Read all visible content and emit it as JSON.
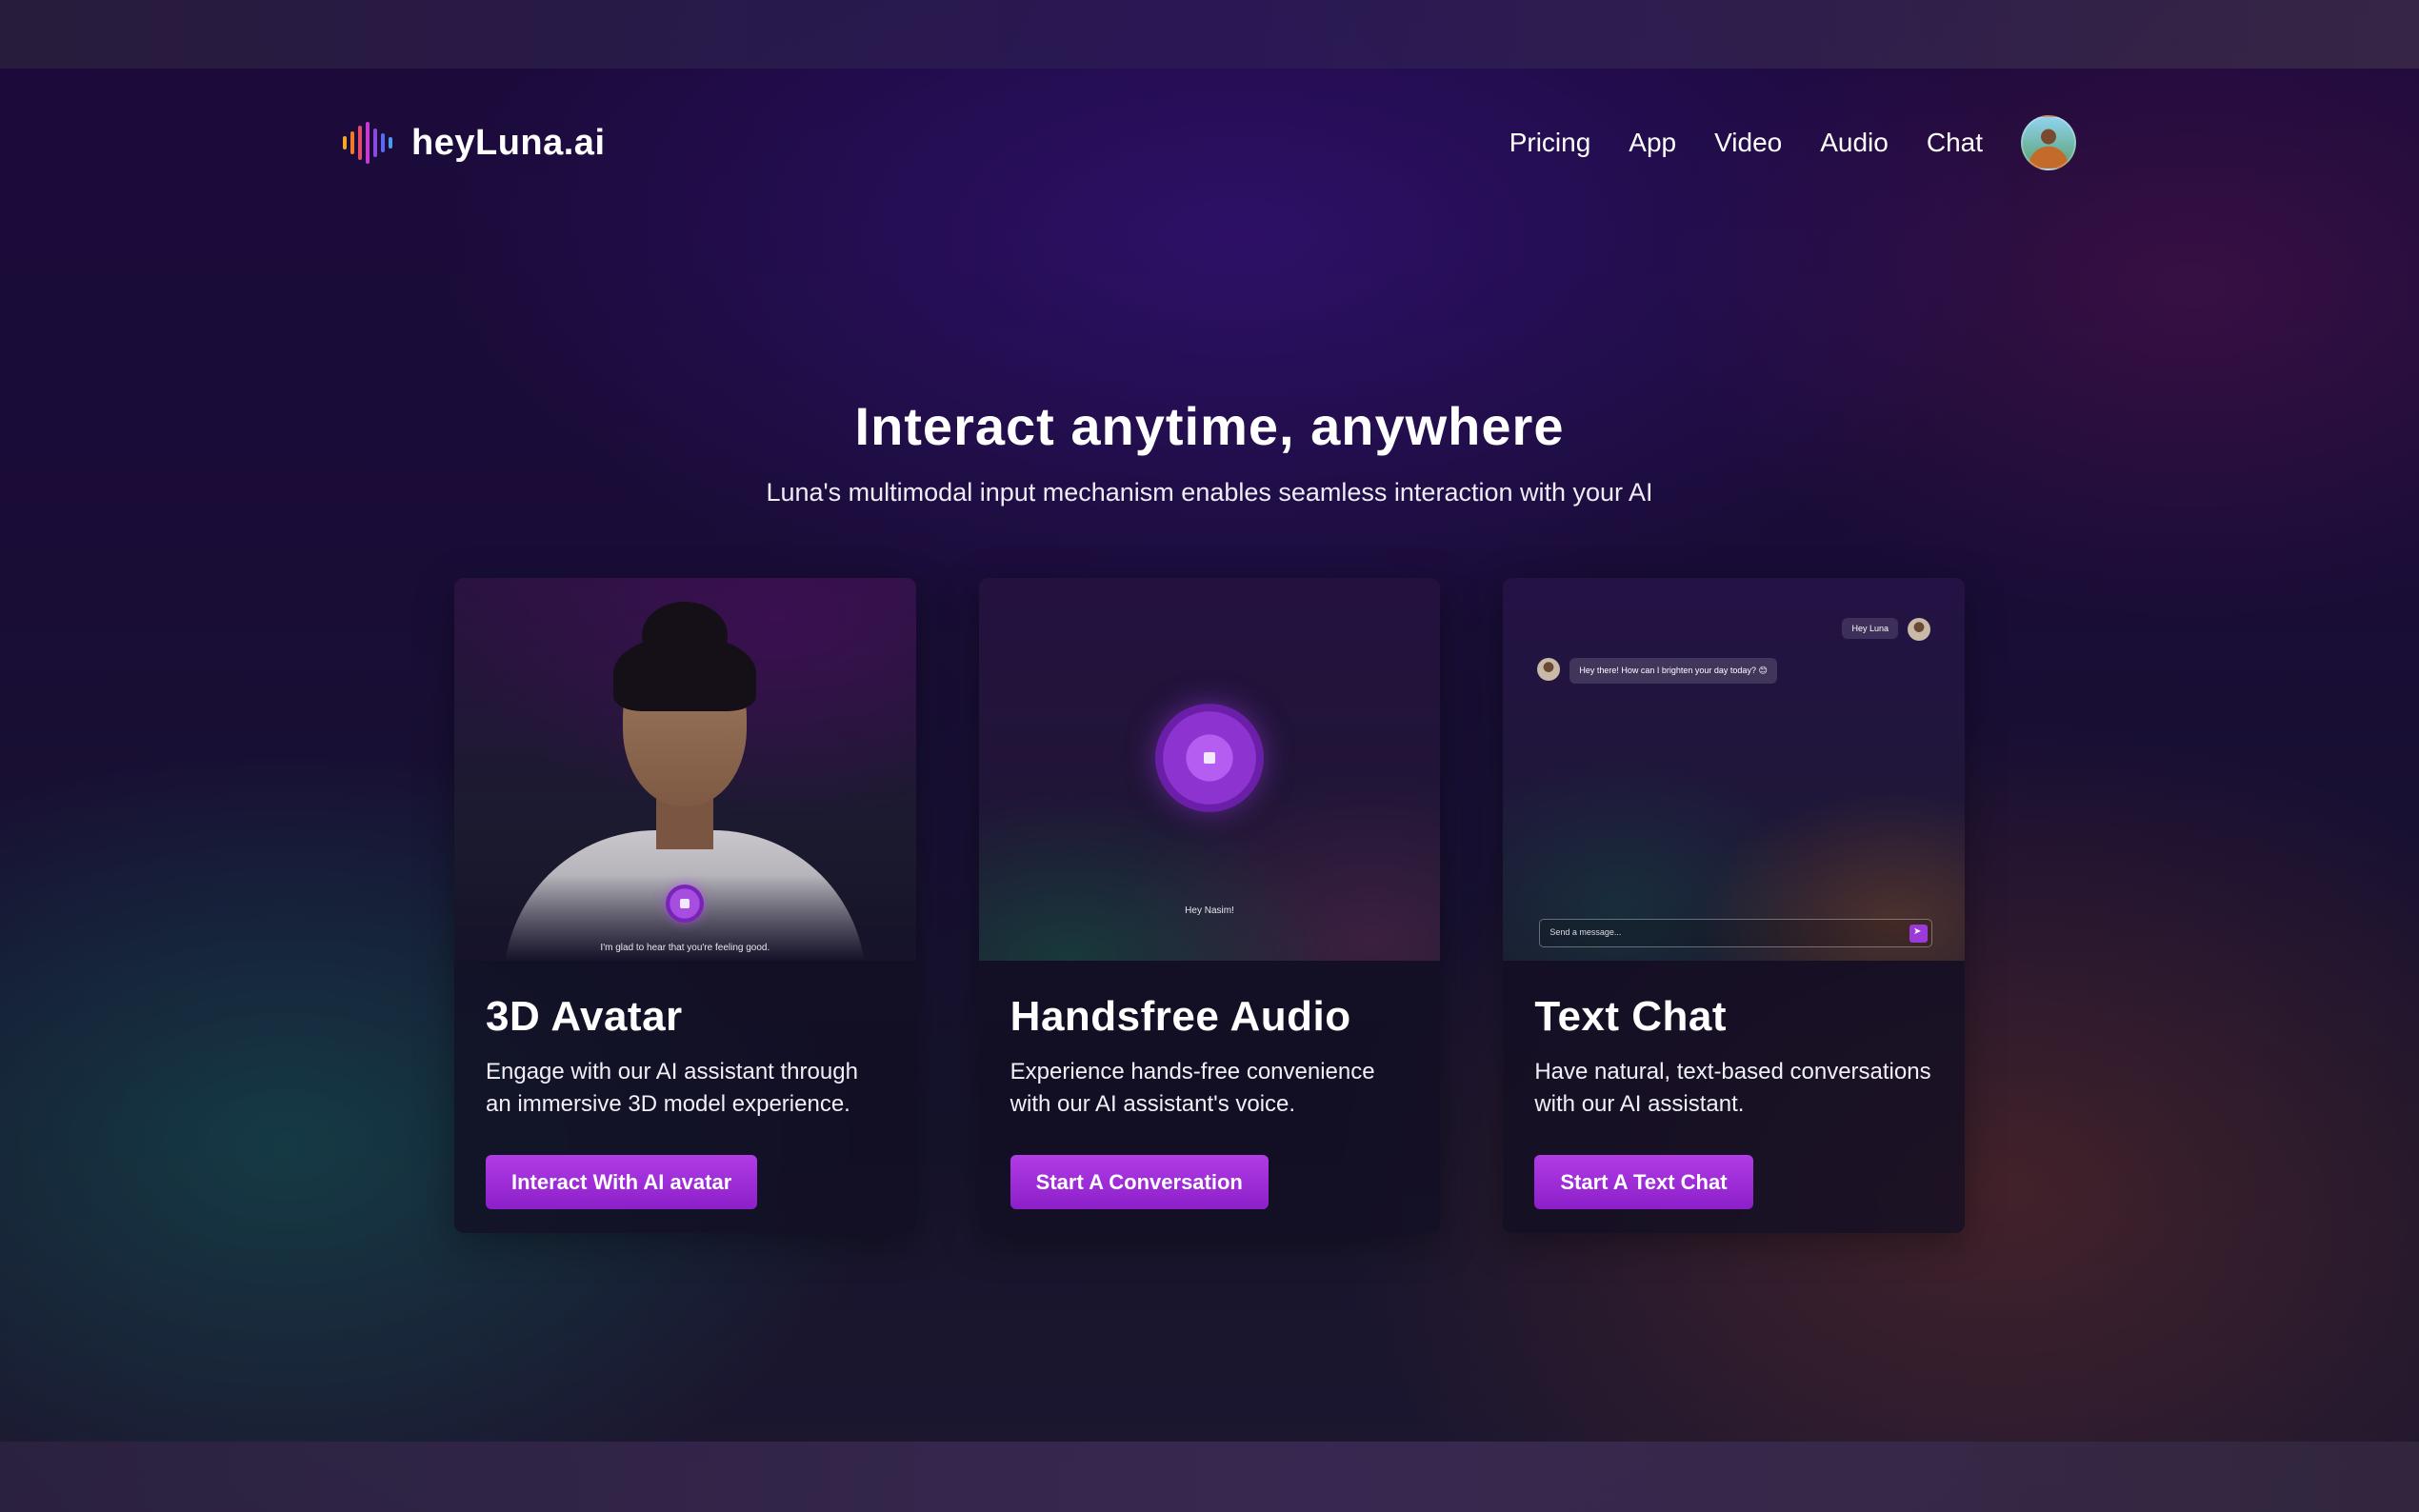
{
  "brand": {
    "name": "heyLuna.ai"
  },
  "nav": {
    "items": [
      "Pricing",
      "App",
      "Video",
      "Audio",
      "Chat"
    ]
  },
  "hero": {
    "title": "Interact anytime, anywhere",
    "subtitle": "Luna's multimodal input mechanism enables seamless interaction with your AI"
  },
  "cards": [
    {
      "title": "3D Avatar",
      "description": "Engage with our AI assistant through an immersive 3D model experience.",
      "button": "Interact With AI avatar",
      "media_caption": "I'm glad to hear that you're feeling good."
    },
    {
      "title": "Handsfree Audio",
      "description": "Experience hands-free convenience with our AI assistant's voice.",
      "button": "Start A Conversation",
      "media_caption": "Hey Nasim!"
    },
    {
      "title": "Text Chat",
      "description": "Have natural, text-based conversations with our AI assistant.",
      "button": "Start A Text Chat",
      "chat_user_message": "Hey Luna",
      "chat_bot_message": "Hey there! How can I brighten your day today? 😊",
      "chat_placeholder": "Send a message..."
    }
  ],
  "colors": {
    "accent": "#a030dd",
    "background": "#1a0f33"
  }
}
